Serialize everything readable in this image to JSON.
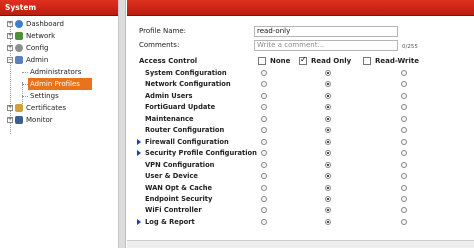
{
  "sidebar": {
    "title": "System",
    "items": [
      {
        "label": "Dashboard",
        "expander": "+"
      },
      {
        "label": "Network",
        "expander": "+"
      },
      {
        "label": "Config",
        "expander": "+"
      },
      {
        "label": "Admin",
        "expander": "−"
      },
      {
        "label": "Administrators"
      },
      {
        "label": "Admin Profiles"
      },
      {
        "label": "Settings"
      },
      {
        "label": "Certificates",
        "expander": "+"
      },
      {
        "label": "Monitor",
        "expander": "+"
      }
    ]
  },
  "form": {
    "profile_name_label": "Profile Name:",
    "profile_name_value": "read-only",
    "comments_label": "Comments:",
    "comments_placeholder": "Write a comment...",
    "comments_counter": "0/255",
    "access_control_label": "Access Control"
  },
  "columns": {
    "none": "None",
    "read_only": "Read Only",
    "read_write": "Read-Write",
    "header_selected": "read_only"
  },
  "permissions": [
    {
      "label": "System Configuration",
      "expandable": false,
      "selected": "read_only"
    },
    {
      "label": "Network Configuration",
      "expandable": false,
      "selected": "read_only"
    },
    {
      "label": "Admin Users",
      "expandable": false,
      "selected": "read_only"
    },
    {
      "label": "FortiGuard Update",
      "expandable": false,
      "selected": "read_only"
    },
    {
      "label": "Maintenance",
      "expandable": false,
      "selected": "read_only"
    },
    {
      "label": "Router Configuration",
      "expandable": false,
      "selected": "read_only"
    },
    {
      "label": "Firewall Configuration",
      "expandable": true,
      "selected": "read_only"
    },
    {
      "label": "Security Profile Configuration",
      "expandable": true,
      "selected": "read_only"
    },
    {
      "label": "VPN Configuration",
      "expandable": false,
      "selected": "read_only"
    },
    {
      "label": "User & Device",
      "expandable": false,
      "selected": "read_only"
    },
    {
      "label": "WAN Opt & Cache",
      "expandable": false,
      "selected": "read_only"
    },
    {
      "label": "Endpoint Security",
      "expandable": false,
      "selected": "read_only"
    },
    {
      "label": "WiFi Controller",
      "expandable": false,
      "selected": "read_only"
    },
    {
      "label": "Log & Report",
      "expandable": true,
      "selected": "read_only"
    }
  ],
  "colors": {
    "header_red": "#c9251a",
    "selection_orange": "#e8731b",
    "caret_blue": "#1a3fa8"
  }
}
